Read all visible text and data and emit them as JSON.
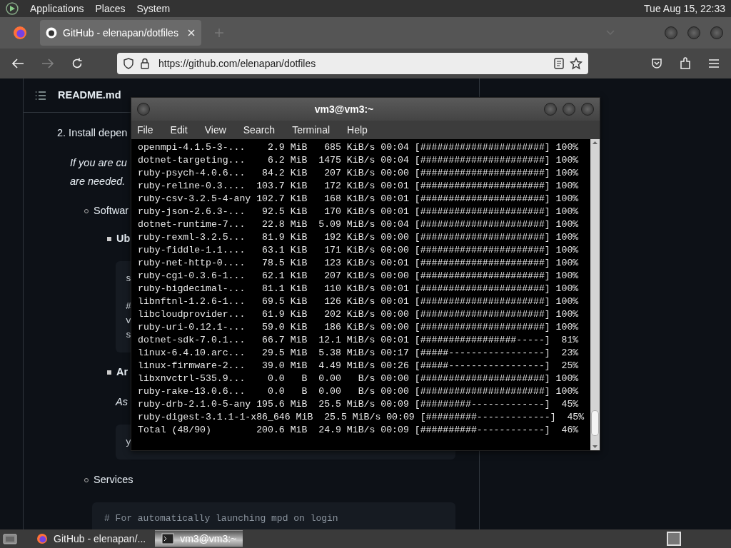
{
  "top_panel": {
    "menus": [
      "Applications",
      "Places",
      "System"
    ],
    "clock": "Tue Aug 15, 22:33"
  },
  "browser": {
    "tabs": [
      {
        "title": "GitHub - elenapan/dotfiles",
        "selected": true
      }
    ],
    "url": "https://github.com/elenapan/dotfiles",
    "forward_disabled": true
  },
  "readme": {
    "title": "README.md",
    "blocks": [
      {
        "kind": "step",
        "text": "2. Install depen"
      },
      {
        "kind": "note",
        "lines": [
          "If you are cu",
          "are needed."
        ]
      },
      {
        "kind": "bullet",
        "text": "Softwar"
      },
      {
        "kind": "subbullet",
        "text": "Ub"
      },
      {
        "kind": "code",
        "groups": [
          [
            "s"
          ],
          [
            "#",
            "v",
            "s"
          ]
        ]
      },
      {
        "kind": "subbullet",
        "text": "Ar"
      },
      {
        "kind": "subnote",
        "lines": [
          "As"
        ]
      },
      {
        "kind": "code",
        "groups": [
          [
            "y"
          ]
        ]
      },
      {
        "kind": "bullet",
        "text": "Services"
      },
      {
        "kind": "widecode",
        "groups": [
          [
            "# For automatically launching mpd on login"
          ]
        ]
      }
    ]
  },
  "terminal": {
    "title": "vm3@vm3:~",
    "menus": [
      "File",
      "Edit",
      "View",
      "Search",
      "Terminal",
      "Help"
    ],
    "lines": [
      "openmpi-4.1.5-3-...    2.9 MiB   685 KiB/s 00:04 [######################] 100%",
      "dotnet-targeting...    6.2 MiB  1475 KiB/s 00:04 [######################] 100%",
      "ruby-psych-4.0.6...   84.2 KiB   207 KiB/s 00:00 [######################] 100%",
      "ruby-reline-0.3....  103.7 KiB   172 KiB/s 00:01 [######################] 100%",
      "ruby-csv-3.2.5-4-any 102.7 KiB   168 KiB/s 00:01 [######################] 100%",
      "ruby-json-2.6.3-...   92.5 KiB   170 KiB/s 00:01 [######################] 100%",
      "dotnet-runtime-7...   22.8 MiB  5.09 MiB/s 00:04 [######################] 100%",
      "ruby-rexml-3.2.5...   81.9 KiB   192 KiB/s 00:00 [######################] 100%",
      "ruby-fiddle-1.1....   63.1 KiB   171 KiB/s 00:00 [######################] 100%",
      "ruby-net-http-0....   78.5 KiB   123 KiB/s 00:01 [######################] 100%",
      "ruby-cgi-0.3.6-1...   62.1 KiB   207 KiB/s 00:00 [######################] 100%",
      "ruby-bigdecimal-...   81.1 KiB   110 KiB/s 00:01 [######################] 100%",
      "libnftnl-1.2.6-1...   69.5 KiB   126 KiB/s 00:01 [######################] 100%",
      "libcloudprovider...   61.9 KiB   202 KiB/s 00:00 [######################] 100%",
      "ruby-uri-0.12.1-...   59.0 KiB   186 KiB/s 00:00 [######################] 100%",
      "dotnet-sdk-7.0.1...   66.7 MiB  12.1 MiB/s 00:01 [#################-----]  81%",
      "linux-6.4.10.arc...   29.5 MiB  5.38 MiB/s 00:17 [#####-----------------]  23%",
      "linux-firmware-2...   39.0 MiB  4.49 MiB/s 00:26 [#####-----------------]  25%",
      "libxnvctrl-535.9...    0.0   B  0.00   B/s 00:00 [######################] 100%",
      "ruby-rake-13.0.6...    0.0   B  0.00   B/s 00:00 [######################] 100%",
      "ruby-drb-2.1.0-5-any 195.6 MiB  25.5 MiB/s 00:09 [#########-------------]  45%",
      "ruby-digest-3.1.1-1-x86_646 MiB  25.5 MiB/s 00:09 [#########-------------]  45%",
      "Total (48/90)        200.6 MiB  24.9 MiB/s 00:09 [##########------------]  46%"
    ]
  },
  "taskbar": {
    "windows": [
      {
        "kind": "browser",
        "title": "GitHub - elenapan/...",
        "selected": false
      },
      {
        "kind": "terminal",
        "title": "vm3@vm3:~",
        "selected": true
      }
    ]
  }
}
